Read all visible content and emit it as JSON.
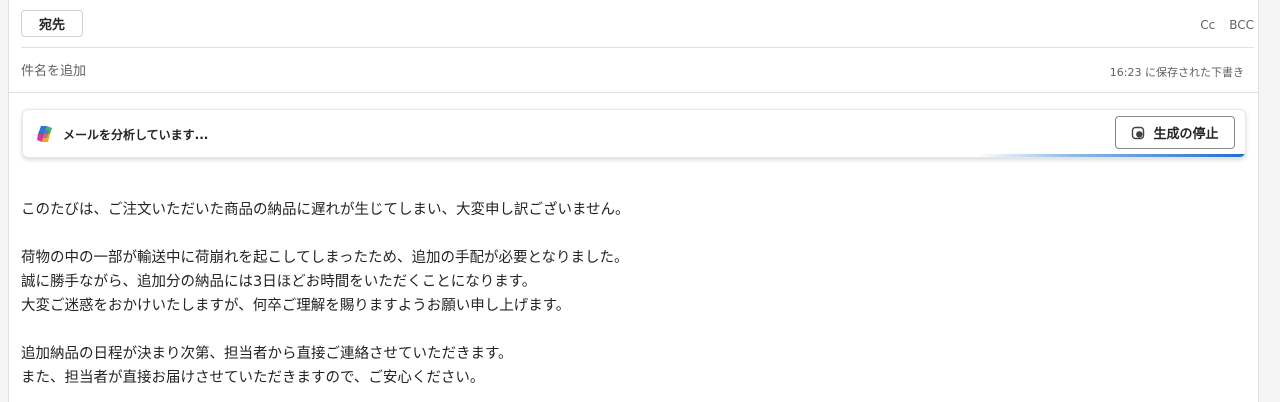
{
  "recipients": {
    "to_label": "宛先",
    "cc_label": "Cc",
    "bcc_label": "BCC"
  },
  "subject": {
    "placeholder": "件名を追加",
    "value": "",
    "saved_status": "16:23 に保存された下書き"
  },
  "copilot": {
    "status_text": "メールを分析しています...",
    "stop_label": "生成の停止",
    "logo_icon": "copilot-logo-icon",
    "stop_icon": "stop-icon",
    "progress_color": "#1f6fd1"
  },
  "body": {
    "paragraphs": [
      [
        "このたびは、ご注文いただいた商品の納品に遅れが生じてしまい、大変申し訳ございません。"
      ],
      [
        "荷物の中の一部が輸送中に荷崩れを起こしてしまったため、追加の手配が必要となりました。",
        "誠に勝手ながら、追加分の納品には3日ほどお時間をいただくことになります。",
        "大変ご迷惑をおかけいたしますが、何卒ご理解を賜りますようお願い申し上げます。"
      ],
      [
        "追加納品の日程が決まり次第、担当者から直接ご連絡させていただきます。",
        "また、担当者が直接お届けさせていただきますので、ご安心ください。"
      ]
    ]
  }
}
